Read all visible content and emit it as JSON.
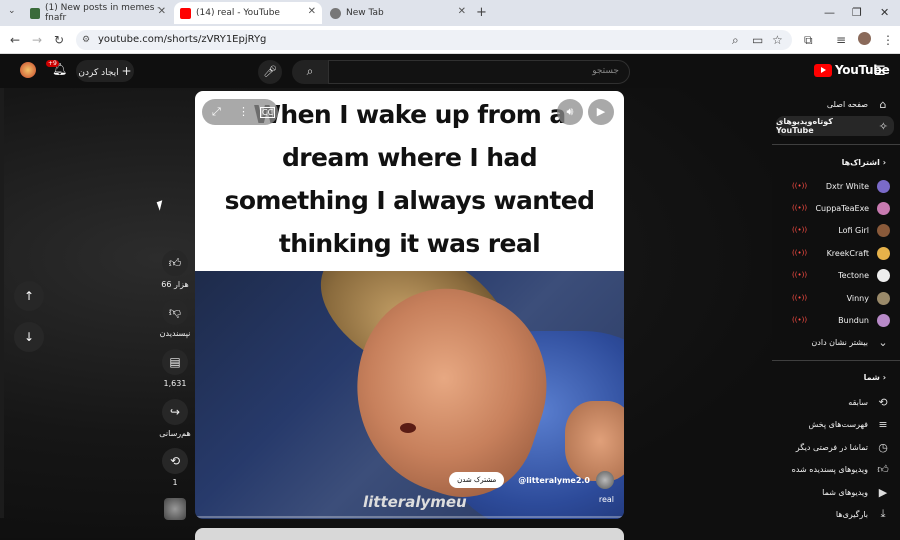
{
  "browser": {
    "tabs": [
      {
        "title": "(1) New posts in memes - fnafr",
        "active": false
      },
      {
        "title": "(14) real - YouTube",
        "active": true
      },
      {
        "title": "New Tab",
        "active": false
      }
    ],
    "url": "youtube.com/shorts/zVRY1EpjRYg"
  },
  "masthead": {
    "logo": "YouTube",
    "search_placeholder": "جستجو",
    "create_label": "ایجاد کردن",
    "notif_badge": "+9"
  },
  "sidebar": {
    "home": "صفحه اصلی",
    "shorts": "کوتاه‌ویدیوهای YouTube",
    "subscriptions_header": "اشتراک‌ها",
    "subscriptions": [
      "Dxtr White",
      "CuppaTeaExe",
      "Lofi Girl",
      "KreekCraft",
      "Tectone",
      "Vinny",
      "Bundun"
    ],
    "show_more": "بیشتر نشان دادن",
    "you_header": "شما",
    "you_items": [
      "سابقه",
      "فهرست‌های پخش",
      "تماشا در فرصتی دیگر",
      "ویدیوهای پسندیده شده",
      "ویدیوهای شما",
      "بارگیری‌ها"
    ]
  },
  "video": {
    "caption_lines": [
      "When I wake up from a",
      "dream where I had",
      "something I always wanted",
      "thinking it was real"
    ],
    "watermark": "litteralymeu",
    "channel": "@litteralyme2.0",
    "subscribe": "مشترک شدن",
    "title": "real"
  },
  "actions": {
    "likes": "66 هزار",
    "dislike": "نپسندیدن",
    "comments": "1,631",
    "share": "هم‌رسانی",
    "remix": "1"
  },
  "colors": {
    "accent": "#ff0000",
    "live": "#ff4e45",
    "bg": "#0f0f0f"
  }
}
